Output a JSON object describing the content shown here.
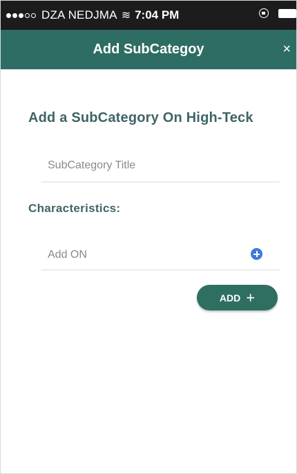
{
  "status_bar": {
    "carrier": "DZA NEDJMA",
    "wifi_icon": "wifi-icon",
    "time": "7:04 PM",
    "signal_full": 3,
    "signal_total": 5
  },
  "header": {
    "title": "Add SubCategoy",
    "close_glyph": "×"
  },
  "form": {
    "heading": "Add a SubCategory On High-Teck",
    "title_placeholder": "SubCategory Title",
    "characteristics_label": "Characteristics:",
    "addon_placeholder": "Add ON",
    "add_button_label": "ADD",
    "add_button_icon": "+"
  },
  "colors": {
    "header_bg": "#2e6d64",
    "accent_text": "#3f6465",
    "plus_circle": "#3b7bd6"
  }
}
